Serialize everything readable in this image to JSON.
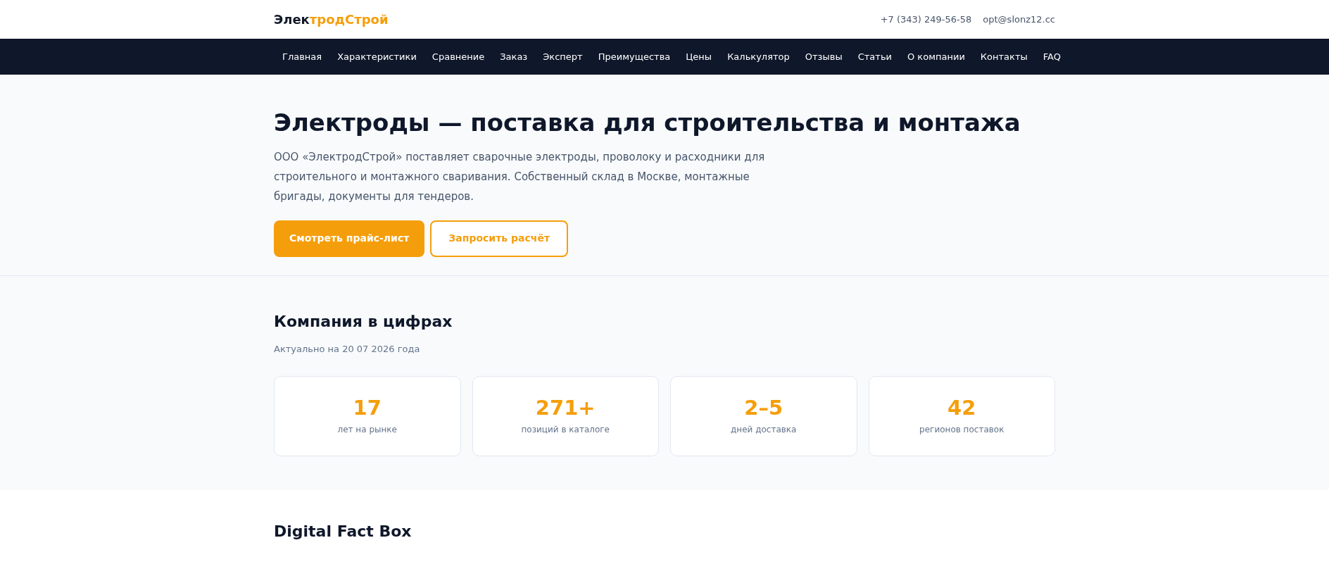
{
  "header": {
    "logo": {
      "first": "Элек",
      "second": "тродСтрой"
    },
    "phone": "+7 (343) 249-56-58",
    "email": "opt@slonz12.cc"
  },
  "nav": [
    "Главная",
    "Характеристики",
    "Сравнение",
    "Заказ",
    "Эксперт",
    "Преимущества",
    "Цены",
    "Калькулятор",
    "Отзывы",
    "Статьи",
    "О компании",
    "Контакты",
    "FAQ"
  ],
  "hero": {
    "title": "Электроды — поставка для строительства и монтажа",
    "text": "ООО «ЭлектродСтрой» поставляет сварочные электроды, проволоку и расходники для строительного и монтажного сваривания. Собственный склад в Москве, монтажные бригады, документы для тендеров.",
    "buttons": [
      {
        "label": "Смотреть прайс-лист",
        "kind": "primary"
      },
      {
        "label": "Запросить расчёт",
        "kind": "outline"
      }
    ]
  },
  "stats": {
    "title": "Компания в цифрах",
    "subtitle": "Актуально на 20 07 2026 года",
    "items": [
      {
        "value": "17",
        "label": "лет на рынке"
      },
      {
        "value": "271+",
        "label": "позиций в каталоге"
      },
      {
        "value": "2–5",
        "label": "дней доставка"
      },
      {
        "value": "42",
        "label": "регионов поставок"
      }
    ]
  },
  "factbox": {
    "title": "Digital Fact Box"
  }
}
